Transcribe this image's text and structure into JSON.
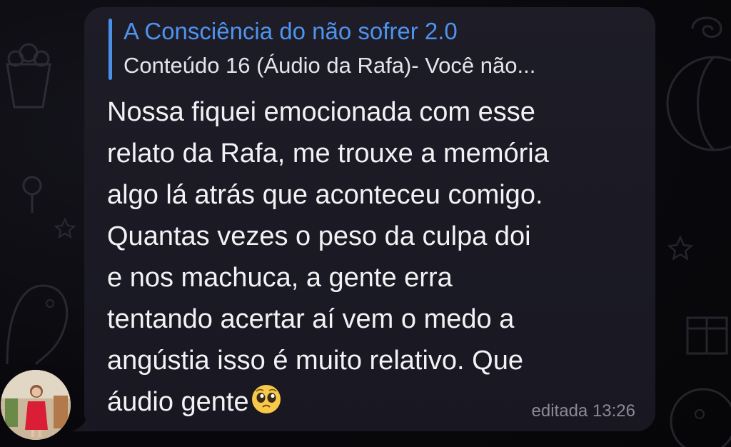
{
  "reply": {
    "title": "A Consciência do não sofrer 2.0",
    "snippet": "Conteúdo 16 (Áudio da Rafa)- Você não..."
  },
  "message": {
    "lines": [
      "Nossa fiquei emocionada com esse",
      "relato da Rafa, me trouxe a memória",
      "algo lá atrás que aconteceu comigo.",
      "Quantas vezes o peso da culpa doi",
      "e nos machuca, a gente erra",
      "tentando acertar aí vem o medo a",
      "angústia isso é muito relativo. Que",
      "áudio gente"
    ],
    "emoji": "pleading-face-emoji"
  },
  "meta": {
    "status": "editada 13:26"
  },
  "colors": {
    "accent": "#4c8fe8",
    "bubble": "#1d1c27",
    "text": "#f2f2f5",
    "meta": "#8a8a96"
  }
}
